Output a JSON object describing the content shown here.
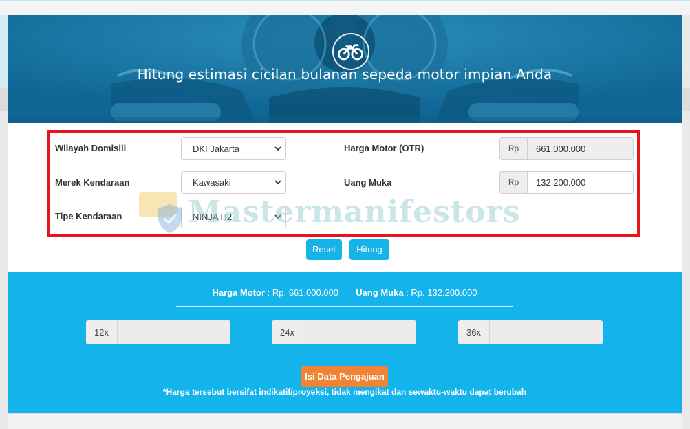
{
  "hero": {
    "title": "Hitung estimasi cicilan bulanan sepeda motor impian Anda",
    "icon": "motorcycle-icon"
  },
  "form": {
    "wilayah": {
      "label": "Wilayah Domisili",
      "value": "DKI Jakarta"
    },
    "merek": {
      "label": "Merek Kendaraan",
      "value": "Kawasaki"
    },
    "tipe": {
      "label": "Tipe Kendaraan",
      "value": "NINJA H2"
    },
    "harga": {
      "label": "Harga Motor (OTR)",
      "prefix": "Rp",
      "value": "661.000.000"
    },
    "uang_muka": {
      "label": "Uang Muka",
      "prefix": "Rp",
      "value": "132.200.000"
    },
    "reset_label": "Reset",
    "hitung_label": "Hitung",
    "highlight_color": "#e8141b"
  },
  "watermark": {
    "text": "Mastermanifestors"
  },
  "results": {
    "harga_label": "Harga Motor",
    "harga_value": ": Rp. 661.000.000",
    "dp_label": "Uang Muka",
    "dp_value": ": Rp. 132.200.000",
    "tenors": [
      {
        "label": "12x",
        "value": ""
      },
      {
        "label": "24x",
        "value": ""
      },
      {
        "label": "36x",
        "value": ""
      }
    ],
    "apply_label": "Isi Data Pengajuan",
    "note": "*Harga tersebut bersifat indikatif/proyeksi, tidak mengikat dan sewaktu-waktu dapat berubah"
  },
  "colors": {
    "accent": "#16b2ea",
    "results_bg": "#13b3ec",
    "apply_button": "#f08434"
  }
}
